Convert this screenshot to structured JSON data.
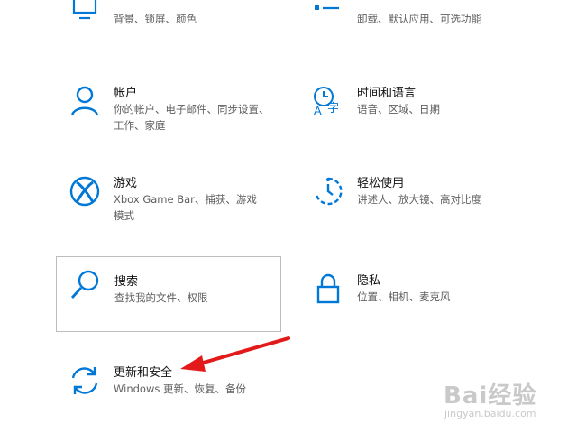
{
  "colors": {
    "accent": "#0078d7",
    "annotation_arrow": "#e31a1a"
  },
  "settings": [
    {
      "id": "personalization",
      "title": "",
      "desc": "背景、锁屏、颜色",
      "icon": "monitor-brush-icon"
    },
    {
      "id": "apps",
      "title": "",
      "desc": "卸载、默认应用、可选功能",
      "icon": "apps-list-icon"
    },
    {
      "id": "accounts",
      "title": "帐户",
      "desc": "你的帐户、电子邮件、同步设置、工作、家庭",
      "icon": "person-icon"
    },
    {
      "id": "time-language",
      "title": "时间和语言",
      "desc": "语音、区域、日期",
      "icon": "time-language-icon"
    },
    {
      "id": "gaming",
      "title": "游戏",
      "desc": "Xbox Game Bar、捕获、游戏模式",
      "icon": "xbox-icon"
    },
    {
      "id": "ease-of-access",
      "title": "轻松使用",
      "desc": "讲述人、放大镜、高对比度",
      "icon": "ease-of-access-icon"
    },
    {
      "id": "search",
      "title": "搜索",
      "desc": "查找我的文件、权限",
      "icon": "search-icon"
    },
    {
      "id": "privacy",
      "title": "隐私",
      "desc": "位置、相机、麦克风",
      "icon": "lock-icon"
    },
    {
      "id": "update-security",
      "title": "更新和安全",
      "desc": "Windows 更新、恢复、备份",
      "icon": "sync-arrows-icon"
    }
  ],
  "watermark": {
    "brand": "Bai经验",
    "url": "jingyan.baidu.com"
  }
}
